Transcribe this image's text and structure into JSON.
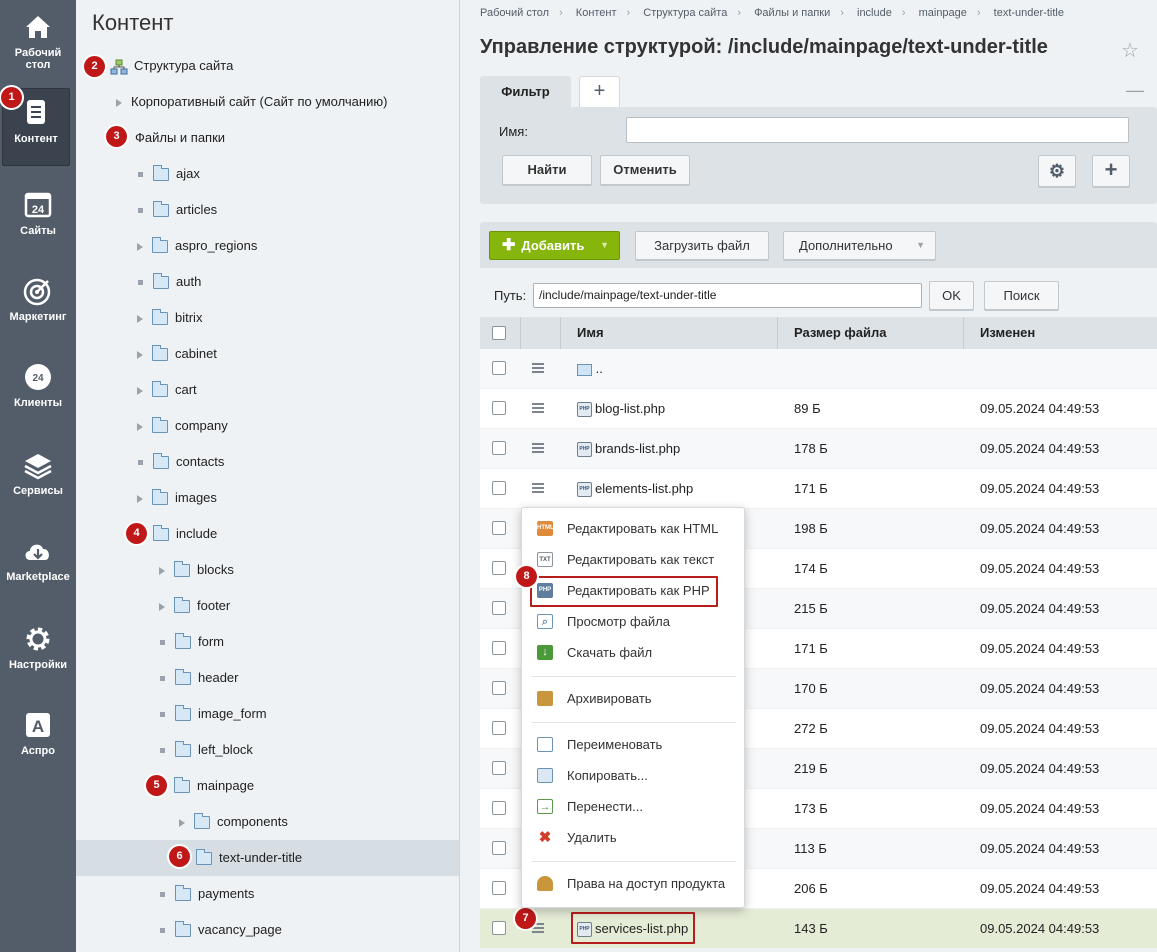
{
  "left_menu": [
    {
      "label": "Рабочий стол",
      "icon": "home-icon"
    },
    {
      "label": "Контент",
      "icon": "document-icon",
      "active": true
    },
    {
      "label": "Сайты",
      "icon": "calendar-24-icon"
    },
    {
      "label": "Маркетинг",
      "icon": "target-icon"
    },
    {
      "label": "Клиенты",
      "icon": "clients-24-icon"
    },
    {
      "label": "Сервисы",
      "icon": "layers-icon"
    },
    {
      "label": "Marketplace",
      "icon": "cloud-download-icon"
    },
    {
      "label": "Настройки",
      "icon": "gear-icon"
    },
    {
      "label": "Аспро",
      "icon": "letter-a-icon"
    }
  ],
  "tree": {
    "title": "Контент",
    "site_structure": "Структура сайта",
    "corp_site": "Корпоративный сайт (Сайт по умолчанию)",
    "files": "Файлы и папки",
    "folders": [
      "ajax",
      "articles",
      "aspro_regions",
      "auth",
      "bitrix",
      "cabinet",
      "cart",
      "company",
      "contacts",
      "images",
      "include"
    ],
    "include_children": [
      "blocks",
      "footer",
      "form",
      "header",
      "image_form",
      "left_block",
      "mainpage"
    ],
    "mainpage_children": [
      "components",
      "text-under-title"
    ],
    "after": [
      "payments",
      "vacancy_page"
    ]
  },
  "breadcrumbs": [
    "Рабочий стол",
    "Контент",
    "Структура сайта",
    "Файлы и папки",
    "include",
    "mainpage",
    "text-under-title"
  ],
  "page_title": "Управление структурой: /include/mainpage/text-under-title",
  "filter": {
    "tab": "Фильтр",
    "add_tab": "+",
    "minimize": "—",
    "name_label": "Имя:",
    "name_value": "",
    "search_btn": "Найти",
    "cancel_btn": "Отменить",
    "gear": "⚙",
    "plus": "+"
  },
  "toolbar": {
    "add": "Добавить",
    "upload": "Загрузить файл",
    "more": "Дополнительно"
  },
  "path": {
    "label": "Путь:",
    "value": "/include/mainpage/text-under-title",
    "ok": "OK",
    "search": "Поиск"
  },
  "grid": {
    "columns": [
      "Имя",
      "Размер файла",
      "Изменен"
    ],
    "up": "..",
    "rows": [
      {
        "name": "blog-list.php",
        "size": "89 Б",
        "date": "09.05.2024 04:49:53"
      },
      {
        "name": "brands-list.php",
        "size": "178 Б",
        "date": "09.05.2024 04:49:53"
      },
      {
        "name": "elements-list.php",
        "size": "171 Б",
        "date": "09.05.2024 04:49:53"
      },
      {
        "name": "",
        "size": "198 Б",
        "date": "09.05.2024 04:49:53"
      },
      {
        "name": "",
        "size": "174 Б",
        "date": "09.05.2024 04:49:53"
      },
      {
        "name": "",
        "size": "215 Б",
        "date": "09.05.2024 04:49:53"
      },
      {
        "name": "",
        "size": "171 Б",
        "date": "09.05.2024 04:49:53"
      },
      {
        "name": "",
        "size": "170 Б",
        "date": "09.05.2024 04:49:53"
      },
      {
        "name": "",
        "size": "272 Б",
        "date": "09.05.2024 04:49:53"
      },
      {
        "name": "",
        "size": "219 Б",
        "date": "09.05.2024 04:49:53"
      },
      {
        "name": "",
        "size": "173 Б",
        "date": "09.05.2024 04:49:53"
      },
      {
        "name": "",
        "size": "113 Б",
        "date": "09.05.2024 04:49:53"
      },
      {
        "name": "",
        "size": "206 Б",
        "date": "09.05.2024 04:49:53"
      },
      {
        "name": "services-list.php",
        "size": "143 Б",
        "date": "09.05.2024 04:49:53"
      }
    ]
  },
  "context_menu": [
    {
      "label": "Редактировать как HTML",
      "icon": "html-icon",
      "color": "#e08a3c"
    },
    {
      "label": "Редактировать как текст",
      "icon": "txt-icon",
      "color": "#8c949b"
    },
    {
      "label": "Редактировать как PHP",
      "icon": "php-icon",
      "color": "#5f7d9c"
    },
    {
      "label": "Просмотр файла",
      "icon": "magnifier-icon",
      "color": "#6a93b8"
    },
    {
      "label": "Скачать файл",
      "icon": "download-icon",
      "color": "#4a9a3a"
    },
    {
      "label": "Архивировать",
      "icon": "archive-box-icon",
      "color": "#c9963d"
    },
    {
      "label": "Переименовать",
      "icon": "rename-icon",
      "color": "#6a93b8"
    },
    {
      "label": "Копировать...",
      "icon": "copy-icon",
      "color": "#6a93b8"
    },
    {
      "label": "Перенести...",
      "icon": "move-icon",
      "color": "#5a9a4a"
    },
    {
      "label": "Удалить",
      "icon": "delete-x-icon",
      "color": "#d23c2a"
    },
    {
      "label": "Права на доступ продукта",
      "icon": "user-lock-icon",
      "color": "#c9963d"
    }
  ],
  "badges": [
    "1",
    "2",
    "3",
    "4",
    "5",
    "6",
    "7",
    "8"
  ],
  "colors": {
    "accent_green": "#86b60c",
    "badge_red": "#c01818",
    "sidebar": "#535c69"
  }
}
